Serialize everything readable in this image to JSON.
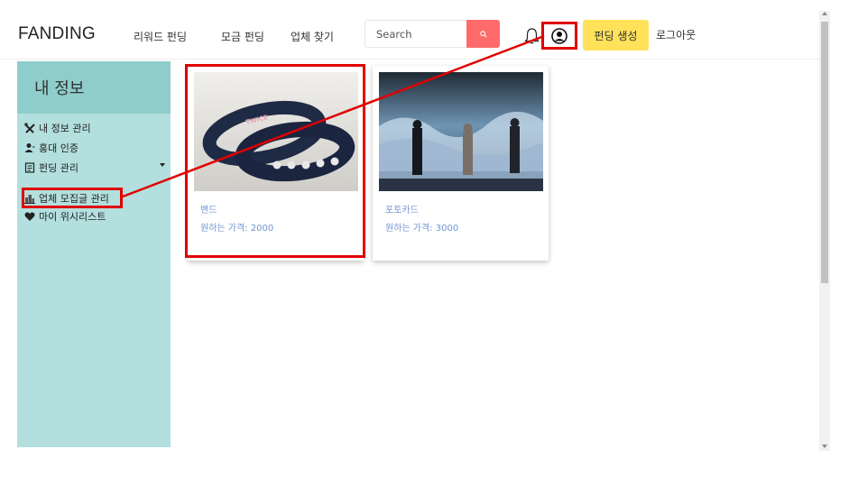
{
  "header": {
    "brand": "FANDING",
    "nav": [
      "리워드 펀딩",
      "모금 펀딩",
      "업체 찾기"
    ],
    "search": {
      "placeholder": "Search",
      "value": ""
    },
    "create_label": "펀딩 생성",
    "logout_label": "로그아웃"
  },
  "icons": {
    "search": "search-icon",
    "notification": "bell-icon",
    "profile": "user-circle-icon"
  },
  "colors": {
    "search_button": "#ff6b6b",
    "create_button": "#ffe15a",
    "sidebar": "#b3dfde",
    "sidebar_header": "#8ecdca",
    "card_text": "#6f95d6",
    "highlight": "#e00000"
  },
  "sidebar": {
    "title": "내 정보",
    "items": [
      {
        "label": "내 정보 관리",
        "icon": "tools-icon"
      },
      {
        "label": "홍대 인증",
        "icon": "user-icon"
      },
      {
        "label": "펀딩 관리",
        "icon": "document-icon"
      },
      {
        "label": "업체 모집글 관리",
        "icon": "building-icon"
      },
      {
        "label": "마이 위시리스트",
        "icon": "heart-icon"
      }
    ]
  },
  "cards": [
    {
      "title": "밴드",
      "price": "원하는 가격: 2000",
      "image_text": "TWICE"
    },
    {
      "title": "포토카드",
      "price": "원하는 가격: 3000"
    }
  ]
}
